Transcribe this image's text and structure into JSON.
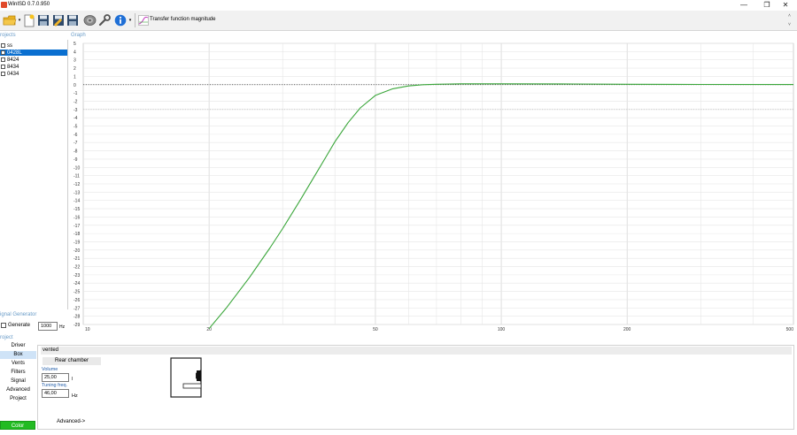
{
  "window": {
    "title": "WinISD 0.7.0.950",
    "minimize_glyph": "—",
    "maximize_glyph": "❐",
    "close_glyph": "✕"
  },
  "toolbar": {
    "graph_type_label": "Transfer function magnitude",
    "icons": [
      "open-folder-icon",
      "new-document-icon",
      "save-icon",
      "save-as-icon",
      "save-all-icon",
      "driver-icon",
      "wrench-icon",
      "info-icon",
      "transfer-function-icon"
    ],
    "dropdown_glyph": "▾"
  },
  "projects": {
    "section_label": "rojects",
    "items": [
      {
        "label": "ss",
        "checked": false,
        "selected": false
      },
      {
        "label": "0428L",
        "checked": false,
        "selected": true
      },
      {
        "label": "8424",
        "checked": false,
        "selected": false
      },
      {
        "label": "8434",
        "checked": false,
        "selected": false
      },
      {
        "label": "0434",
        "checked": false,
        "selected": false
      }
    ]
  },
  "graph": {
    "section_label": "Graph"
  },
  "chart_data": {
    "type": "line",
    "xscale": "log",
    "xlim": [
      10,
      500
    ],
    "ylim": [
      -29,
      5
    ],
    "x_ticks": [
      10,
      20,
      50,
      100,
      200,
      500
    ],
    "y_ticks": [
      5,
      4,
      3,
      2,
      1,
      0,
      -1,
      -2,
      -3,
      -4,
      -5,
      -6,
      -7,
      -8,
      -9,
      -10,
      -11,
      -12,
      -13,
      -14,
      -15,
      -16,
      -17,
      -18,
      -19,
      -20,
      -21,
      -22,
      -23,
      -24,
      -25,
      -26,
      -27,
      -28,
      -29
    ],
    "grid": true,
    "reference_lines": [
      {
        "y": 0,
        "style": "dotted",
        "color": "#333333"
      },
      {
        "y": -3,
        "style": "dotted",
        "color": "#aaaaaa"
      }
    ],
    "series": [
      {
        "color": "#3aa63a",
        "points": [
          [
            20,
            -29.5
          ],
          [
            22,
            -27
          ],
          [
            25,
            -23.3
          ],
          [
            28,
            -19.7
          ],
          [
            30,
            -17.4
          ],
          [
            33,
            -14
          ],
          [
            36,
            -10.8
          ],
          [
            38,
            -8.8
          ],
          [
            40,
            -6.9
          ],
          [
            43,
            -4.6
          ],
          [
            46,
            -2.8
          ],
          [
            50,
            -1.3
          ],
          [
            55,
            -0.5
          ],
          [
            60,
            -0.15
          ],
          [
            65,
            0
          ],
          [
            70,
            0.05
          ],
          [
            80,
            0.1
          ],
          [
            100,
            0.1
          ],
          [
            150,
            0.08
          ],
          [
            200,
            0.05
          ],
          [
            300,
            0.03
          ],
          [
            500,
            0.02
          ]
        ]
      }
    ],
    "colors": {
      "grid_major": "#c8c8c8",
      "grid_minor": "#e6e6e6"
    }
  },
  "signal_generator": {
    "section_label": "ignal Generator",
    "generate_label": "Generate",
    "generate_checked": false,
    "frequency": "1000",
    "unit": "Hz"
  },
  "project_section": {
    "section_label": "roject",
    "nav": [
      {
        "label": "Driver",
        "selected": false
      },
      {
        "label": "Box",
        "selected": true
      },
      {
        "label": "Vents",
        "selected": false
      },
      {
        "label": "Filters",
        "selected": false
      },
      {
        "label": "Signal",
        "selected": false
      },
      {
        "label": "Advanced",
        "selected": false
      },
      {
        "label": "Project",
        "selected": false
      }
    ],
    "color_button_label": "Color",
    "color_button_color": "#22bb22"
  },
  "box": {
    "type": "vented",
    "chamber_tab": "Rear chamber",
    "volume_label": "Volume",
    "volume_value": "25,00",
    "volume_unit": "l",
    "tuning_label": "Tuning freq.",
    "tuning_value": "46,00",
    "tuning_unit": "Hz",
    "advanced_label": "Advanced->"
  }
}
